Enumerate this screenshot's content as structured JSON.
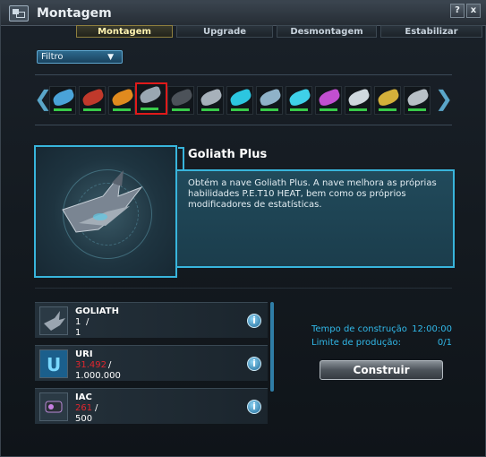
{
  "window": {
    "title": "Montagem",
    "help_label": "?",
    "close_label": "x"
  },
  "tabs": [
    {
      "label": "Montagem",
      "active": true
    },
    {
      "label": "Upgrade",
      "active": false
    },
    {
      "label": "Desmontagem",
      "active": false
    },
    {
      "label": "Estabilizar",
      "active": false
    }
  ],
  "filter": {
    "label": "Filtro"
  },
  "ship_strip": {
    "selected_index": 3,
    "items": [
      {
        "icon": "ship-icon",
        "color": "#4aa3d8"
      },
      {
        "icon": "ship-icon",
        "color": "#c0392b"
      },
      {
        "icon": "ship-icon",
        "color": "#e08a1e"
      },
      {
        "icon": "ship-icon",
        "color": "#9aa7b2"
      },
      {
        "icon": "ship-icon",
        "color": "#4c5259"
      },
      {
        "icon": "ship-icon",
        "color": "#a7b1ba"
      },
      {
        "icon": "ship-icon",
        "color": "#2cc6e0"
      },
      {
        "icon": "ship-icon",
        "color": "#8fb2c8"
      },
      {
        "icon": "ship-icon",
        "color": "#3fd0e8"
      },
      {
        "icon": "ship-icon",
        "color": "#c24fd0"
      },
      {
        "icon": "ship-icon",
        "color": "#cfd8de"
      },
      {
        "icon": "ship-icon",
        "color": "#d4b03a"
      },
      {
        "icon": "ship-icon",
        "color": "#b8c0c6"
      }
    ]
  },
  "detail": {
    "title": "Goliath Plus",
    "description": "Obtém a nave Goliath Plus. A nave melhora as próprias habilidades P.E.T10 HEAT, bem como os próprios modificadores de estatísticas."
  },
  "resources": [
    {
      "name": "GOLIATH",
      "have": "1",
      "need": "1",
      "missing": false,
      "icon": "goliath-ship-icon"
    },
    {
      "name": "URI",
      "have": "31.492",
      "need": "1.000.000",
      "missing": true,
      "icon": "uri-currency-icon"
    },
    {
      "name": "IAC",
      "have": "261",
      "need": "500",
      "missing": true,
      "icon": "iac-module-icon"
    }
  ],
  "stats": {
    "build_time_label": "Tempo de construção",
    "build_time_value": "12:00:00",
    "production_limit_label": "Limite de produção:",
    "production_limit_value": "0/1"
  },
  "build_button": {
    "label": "Construir"
  }
}
